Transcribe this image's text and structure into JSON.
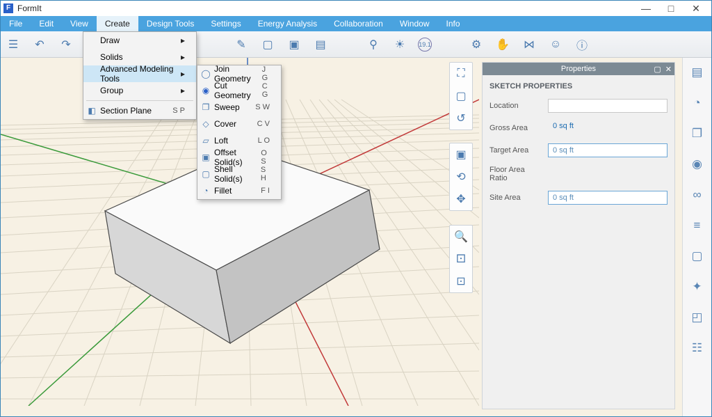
{
  "app": {
    "title": "FormIt"
  },
  "menubar": {
    "file": "File",
    "edit": "Edit",
    "view": "View",
    "create": "Create",
    "design_tools": "Design Tools",
    "settings": "Settings",
    "energy_analysis": "Energy Analysis",
    "collaboration": "Collaboration",
    "window": "Window",
    "info": "Info"
  },
  "dropdown_create": {
    "draw": "Draw",
    "solids": "Solids",
    "adv": "Advanced Modeling Tools",
    "group": "Group",
    "section_plane": "Section Plane",
    "section_plane_sc": "S P"
  },
  "dropdown_adv": {
    "join": {
      "label": "Join Geometry",
      "sc": "J G"
    },
    "cut": {
      "label": "Cut Geometry",
      "sc": "C G"
    },
    "sweep": {
      "label": "Sweep",
      "sc": "S W"
    },
    "cover": {
      "label": "Cover",
      "sc": "C V"
    },
    "loft": {
      "label": "Loft",
      "sc": "L O"
    },
    "offset": {
      "label": "Offset Solid(s)",
      "sc": "O S"
    },
    "shell": {
      "label": "Shell Solid(s)",
      "sc": "S H"
    },
    "fillet": {
      "label": "Fillet",
      "sc": "F I"
    }
  },
  "properties": {
    "panel_title": "Properties",
    "section": "SKETCH PROPERTIES",
    "location_label": "Location",
    "location_value": "",
    "gross_area_label": "Gross Area",
    "gross_area_value": "0 sq ft",
    "target_area_label": "Target Area",
    "target_area_value": "0 sq ft",
    "far_label": "Floor Area Ratio",
    "far_value": "",
    "site_area_label": "Site Area",
    "site_area_value": "0 sq ft"
  },
  "toolbar": {
    "value_label": "19.1"
  }
}
